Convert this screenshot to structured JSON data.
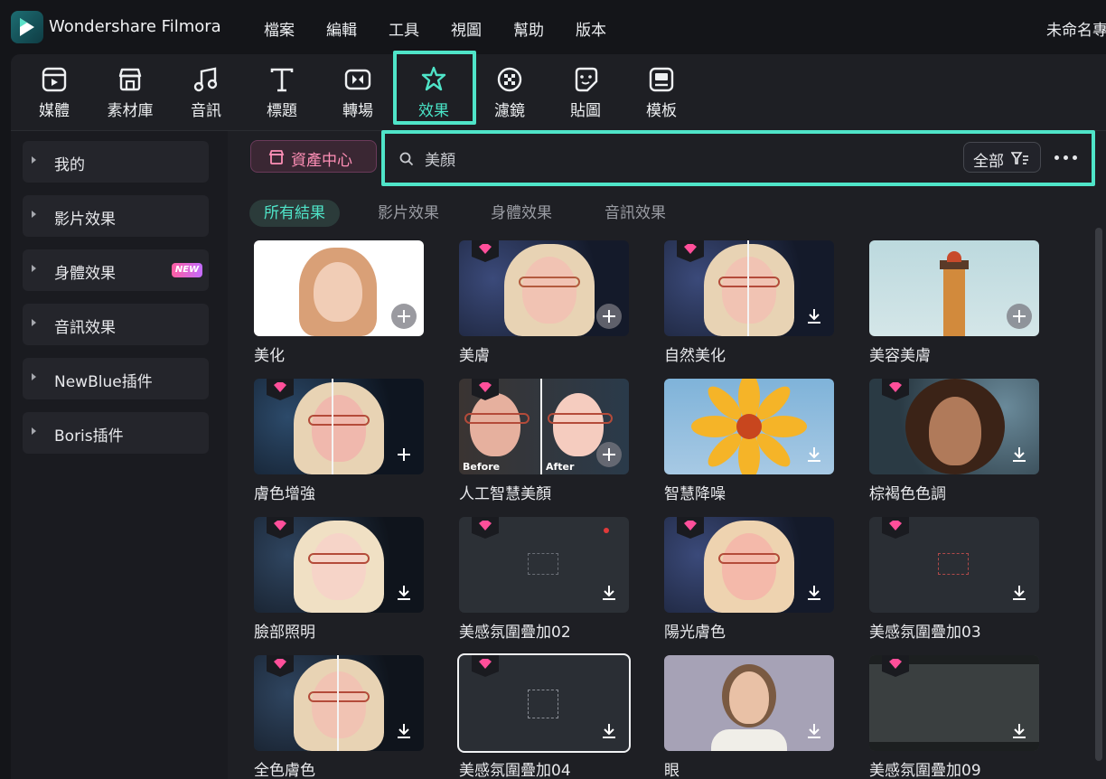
{
  "app": {
    "name": "Wondershare Filmora",
    "project_name": "未命名專"
  },
  "menu": [
    "檔案",
    "編輯",
    "工具",
    "視圖",
    "幫助",
    "版本"
  ],
  "toolbar": {
    "items": [
      {
        "label": "媒體",
        "icon": "media-icon"
      },
      {
        "label": "素材庫",
        "icon": "stock-library-icon"
      },
      {
        "label": "音訊",
        "icon": "music-note-icon"
      },
      {
        "label": "標題",
        "icon": "title-t-icon"
      },
      {
        "label": "轉場",
        "icon": "transition-icon"
      },
      {
        "label": "效果",
        "icon": "effects-sparkle-icon",
        "active": true
      },
      {
        "label": "濾鏡",
        "icon": "filter-icon"
      },
      {
        "label": "貼圖",
        "icon": "sticker-icon"
      },
      {
        "label": "模板",
        "icon": "template-icon"
      }
    ]
  },
  "sidebar": {
    "items": [
      {
        "label": "我的"
      },
      {
        "label": "影片效果"
      },
      {
        "label": "身體效果",
        "badge": "NEW"
      },
      {
        "label": "音訊效果"
      },
      {
        "label": "NewBlue插件"
      },
      {
        "label": "Boris插件"
      }
    ]
  },
  "asset_center": {
    "label": "資產中心"
  },
  "search": {
    "value": "美顏",
    "filter_label": "全部"
  },
  "tabs": [
    "所有結果",
    "影片效果",
    "身體效果",
    "音訊效果"
  ],
  "effects": [
    {
      "name": "美化",
      "premium": false,
      "action": "add"
    },
    {
      "name": "美膚",
      "premium": true,
      "action": "add"
    },
    {
      "name": "自然美化",
      "premium": true,
      "action": "download"
    },
    {
      "name": "美容美膚",
      "premium": false,
      "action": "add"
    },
    {
      "name": "膚色增強",
      "premium": true,
      "action": "add"
    },
    {
      "name": "人工智慧美顏",
      "premium": true,
      "action": "add",
      "before_label": "Before",
      "after_label": "After"
    },
    {
      "name": "智慧降噪",
      "premium": false,
      "action": "download"
    },
    {
      "name": "棕褐色色調",
      "premium": true,
      "action": "download"
    },
    {
      "name": "臉部照明",
      "premium": true,
      "action": "download"
    },
    {
      "name": "美感氛圍疊加02",
      "premium": true,
      "action": "download"
    },
    {
      "name": "陽光膚色",
      "premium": true,
      "action": "download"
    },
    {
      "name": "美感氛圍疊加03",
      "premium": true,
      "action": "download"
    },
    {
      "name": "全色膚色",
      "premium": true,
      "action": "download"
    },
    {
      "name": "美感氛圍疊加04",
      "premium": true,
      "action": "download"
    },
    {
      "name": "眼",
      "premium": false,
      "action": "download"
    },
    {
      "name": "美感氛圍疊加09",
      "premium": true,
      "action": "download"
    }
  ],
  "colors": {
    "accent": "#4fe4c8",
    "premium_gem": "#ff4f9a",
    "asset_center_text": "#ff8fb6"
  }
}
